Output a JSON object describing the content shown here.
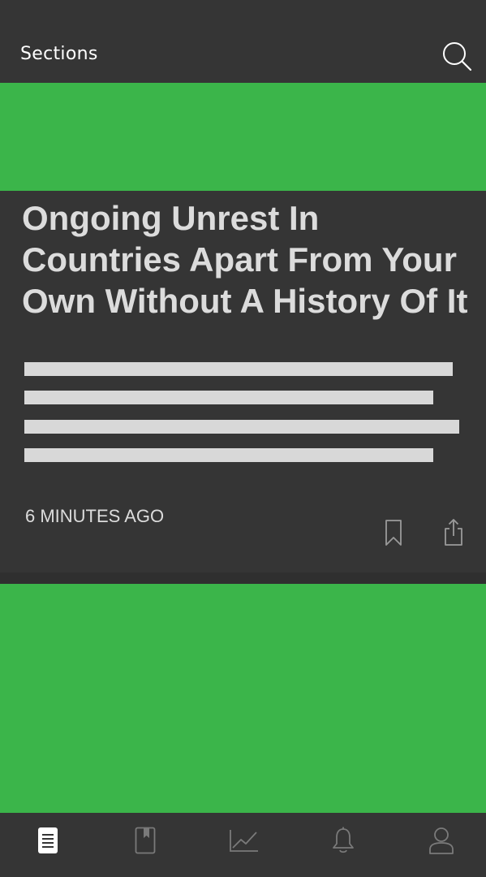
{
  "header": {
    "sections_label": "Sections",
    "search_icon": "search-icon"
  },
  "article": {
    "headline": "Ongoing Unrest In Countries Apart From Your Own Without A History Of It",
    "timestamp": "6 MINUTES AGO",
    "bookmark_icon": "bookmark-icon",
    "share_icon": "share-icon"
  },
  "tabbar": {
    "tabs": [
      {
        "icon": "news-icon",
        "active": true
      },
      {
        "icon": "saved-icon",
        "active": false
      },
      {
        "icon": "markets-icon",
        "active": false
      },
      {
        "icon": "notifications-icon",
        "active": false
      },
      {
        "icon": "profile-icon",
        "active": false
      }
    ]
  },
  "colors": {
    "background": "#353535",
    "accent_green": "#3bb54a",
    "headline_text": "#dcdcdc",
    "placeholder_line": "#d8d8d8"
  }
}
